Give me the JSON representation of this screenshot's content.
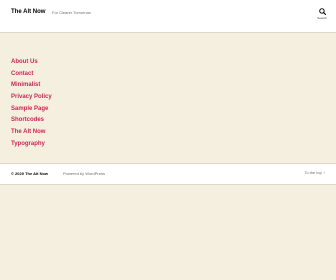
{
  "header": {
    "site_title": "The Alt Now",
    "tagline": "For Clearer Tomorrow",
    "search_label": "Search"
  },
  "menu": {
    "items": [
      {
        "label": "About Us"
      },
      {
        "label": "Contact"
      },
      {
        "label": "Minimalist"
      },
      {
        "label": "Privacy Policy"
      },
      {
        "label": "Sample Page"
      },
      {
        "label": "Shortcodes"
      },
      {
        "label": "The Alt Now"
      },
      {
        "label": "Typography"
      }
    ]
  },
  "footer": {
    "copyright": "© 2020 The Alt Now",
    "powered_by": "Powered by WordPress",
    "to_top": "To the top ↑"
  },
  "colors": {
    "accent": "#cd2653",
    "background": "#f5efe0"
  },
  "icons": {
    "search": "search-icon"
  }
}
